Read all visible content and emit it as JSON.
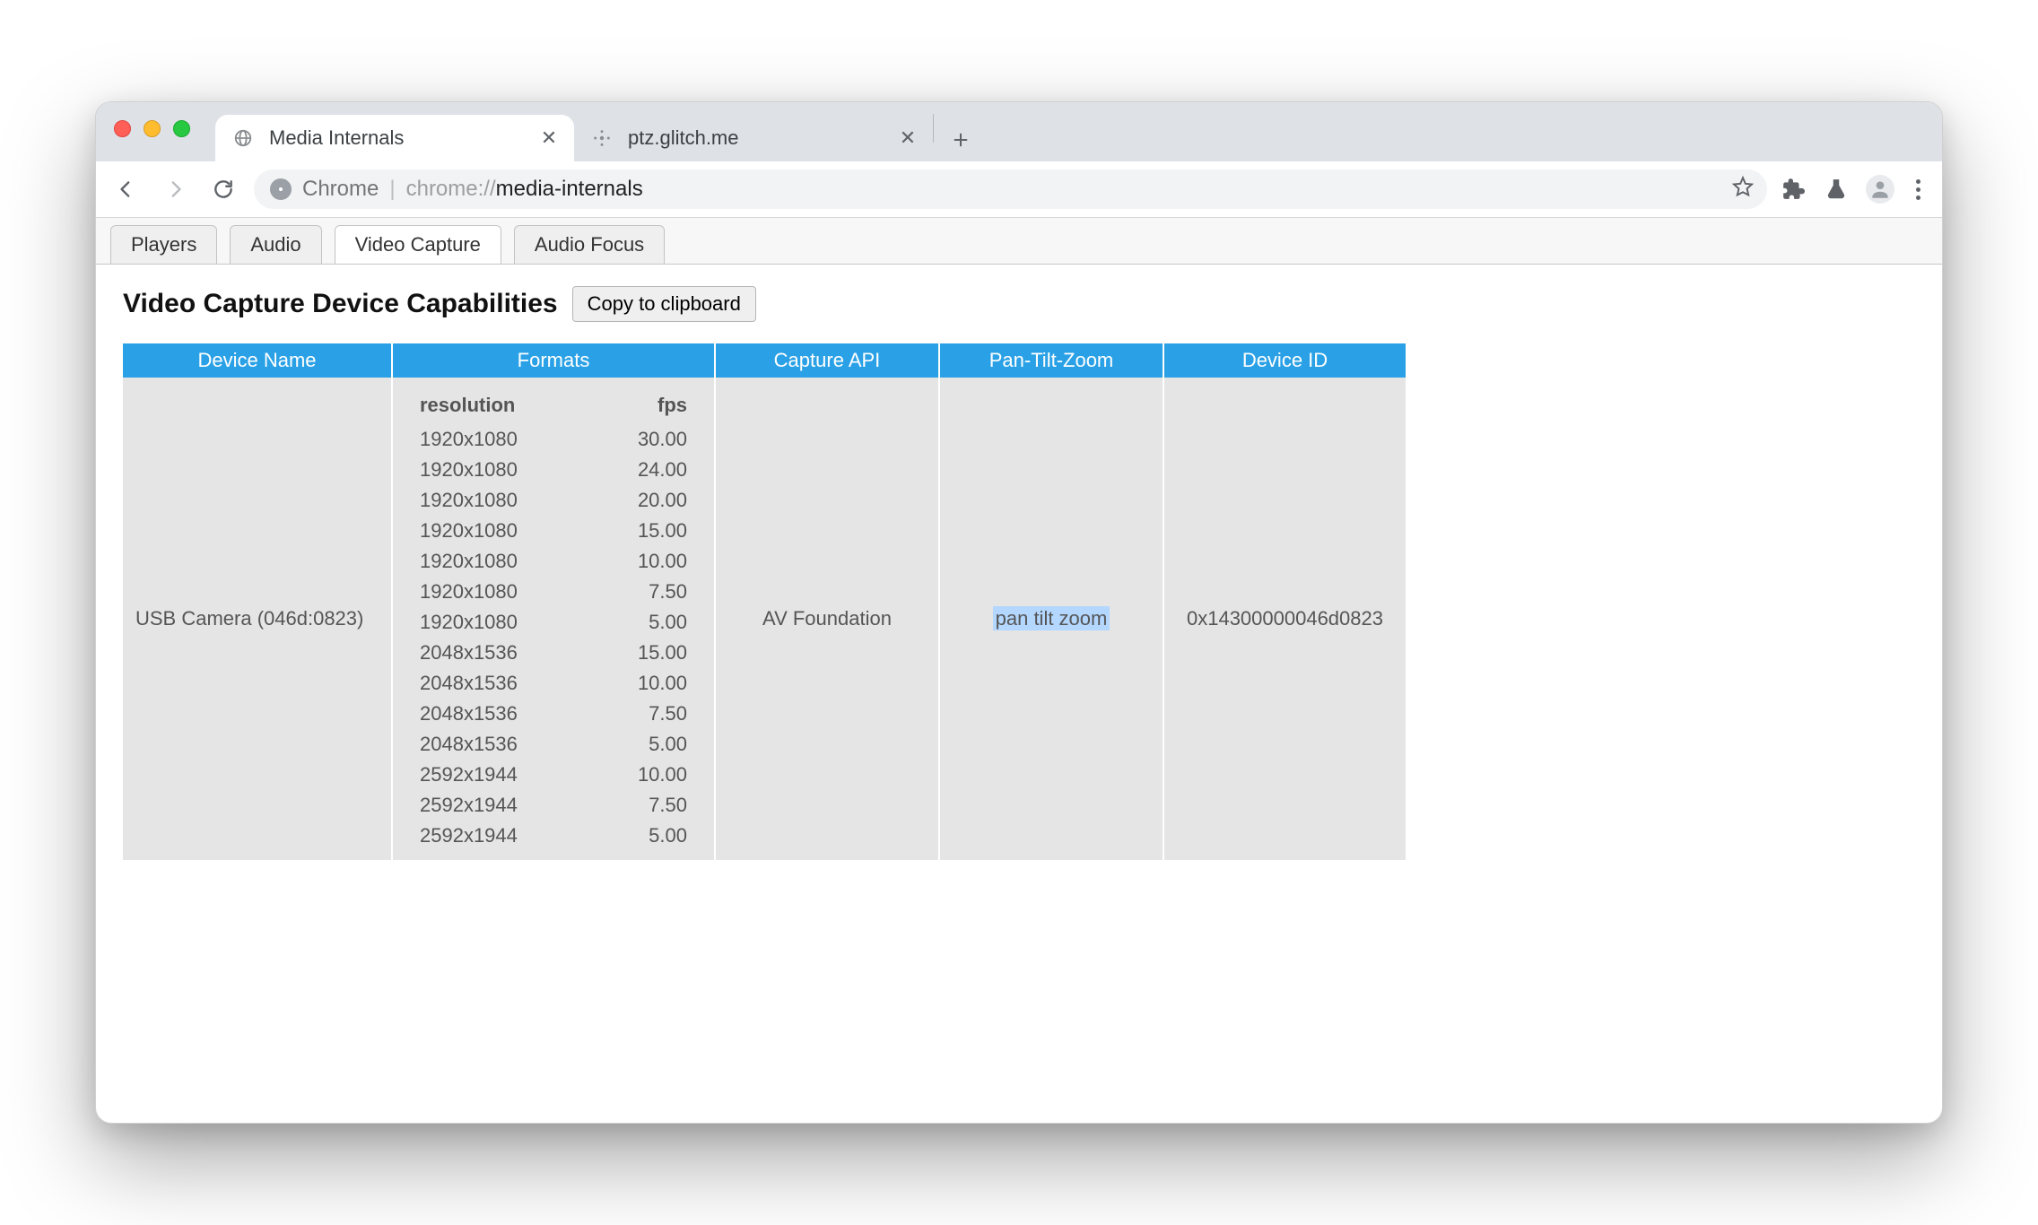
{
  "browser": {
    "tabs": [
      {
        "title": "Media Internals",
        "active": true
      },
      {
        "title": "ptz.glitch.me",
        "active": false
      }
    ],
    "omnibox": {
      "chip": "Chrome",
      "url_gray": "chrome://",
      "url_black": "media-internals"
    }
  },
  "media_tabs": {
    "items": [
      "Players",
      "Audio",
      "Video Capture",
      "Audio Focus"
    ],
    "active_index": 2
  },
  "heading": "Video Capture Device Capabilities",
  "copy_label": "Copy to clipboard",
  "table": {
    "headers": [
      "Device Name",
      "Formats",
      "Capture API",
      "Pan-Tilt-Zoom",
      "Device ID"
    ],
    "formats_headers": {
      "res": "resolution",
      "fps": "fps"
    },
    "row": {
      "device_name": "USB Camera (046d:0823)",
      "capture_api": "AV Foundation",
      "ptz": "pan tilt zoom",
      "device_id": "0x14300000046d0823",
      "formats": [
        {
          "res": "1920x1080",
          "fps": "30.00"
        },
        {
          "res": "1920x1080",
          "fps": "24.00"
        },
        {
          "res": "1920x1080",
          "fps": "20.00"
        },
        {
          "res": "1920x1080",
          "fps": "15.00"
        },
        {
          "res": "1920x1080",
          "fps": "10.00"
        },
        {
          "res": "1920x1080",
          "fps": "7.50"
        },
        {
          "res": "1920x1080",
          "fps": "5.00"
        },
        {
          "res": "2048x1536",
          "fps": "15.00"
        },
        {
          "res": "2048x1536",
          "fps": "10.00"
        },
        {
          "res": "2048x1536",
          "fps": "7.50"
        },
        {
          "res": "2048x1536",
          "fps": "5.00"
        },
        {
          "res": "2592x1944",
          "fps": "10.00"
        },
        {
          "res": "2592x1944",
          "fps": "7.50"
        },
        {
          "res": "2592x1944",
          "fps": "5.00"
        }
      ]
    }
  }
}
